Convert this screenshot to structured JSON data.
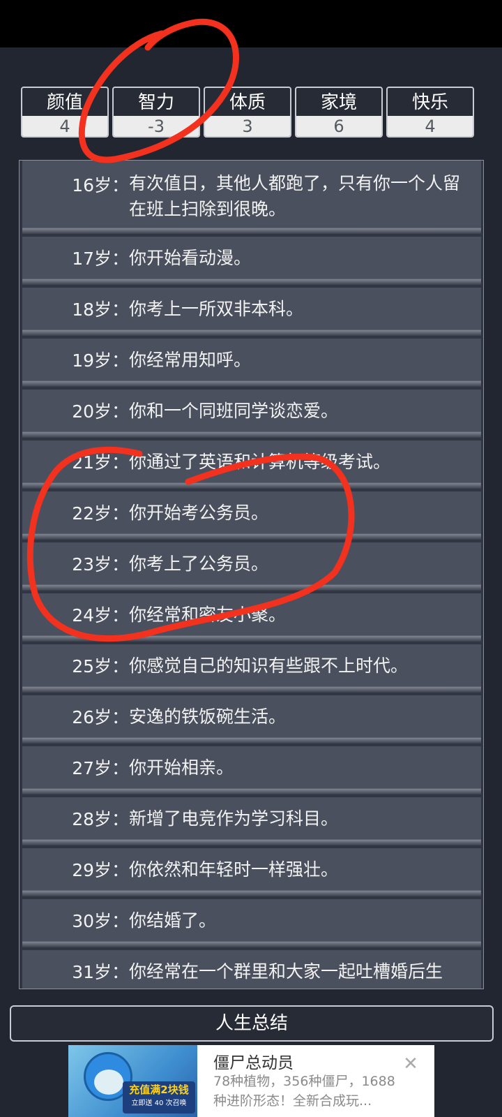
{
  "stats": [
    {
      "label": "颜值",
      "value": "4"
    },
    {
      "label": "智力",
      "value": "-3"
    },
    {
      "label": "体质",
      "value": "3"
    },
    {
      "label": "家境",
      "value": "6"
    },
    {
      "label": "快乐",
      "value": "4"
    }
  ],
  "events": [
    {
      "age": "16岁：",
      "text": "有次值日，其他人都跑了，只有你一个人留在班上扫除到很晚。"
    },
    {
      "age": "17岁：",
      "text": "你开始看动漫。"
    },
    {
      "age": "18岁：",
      "text": "你考上一所双非本科。"
    },
    {
      "age": "19岁：",
      "text": "你经常用知呼。"
    },
    {
      "age": "20岁：",
      "text": "你和一个同班同学谈恋爱。"
    },
    {
      "age": "21岁：",
      "text": "你通过了英语和计算机等级考试。"
    },
    {
      "age": "22岁：",
      "text": "你开始考公务员。"
    },
    {
      "age": "23岁：",
      "text": "你考上了公务员。"
    },
    {
      "age": "24岁：",
      "text": "你经常和密友小聚。"
    },
    {
      "age": "25岁：",
      "text": "你感觉自己的知识有些跟不上时代。"
    },
    {
      "age": "26岁：",
      "text": "安逸的铁饭碗生活。"
    },
    {
      "age": "27岁：",
      "text": "你开始相亲。"
    },
    {
      "age": "28岁：",
      "text": "新增了电竞作为学习科目。"
    },
    {
      "age": "29岁：",
      "text": "你依然和年轻时一样强壮。"
    },
    {
      "age": "30岁：",
      "text": "你结婚了。"
    },
    {
      "age": "31岁：",
      "text": "你经常在一个群里和大家一起吐槽婚后生"
    }
  ],
  "summary_button": {
    "label": "人生总结"
  },
  "ad": {
    "title": "僵尸总动员",
    "description": "78种植物，356种僵尸，1688种进阶形态！全新合成玩...",
    "banner_main": "充值满2块钱",
    "banner_sub": "立即送 40 次召唤",
    "close_glyph": "✕"
  },
  "colors": {
    "background": "#212630",
    "row": "#4a505d",
    "annotation": "#f2311f"
  }
}
